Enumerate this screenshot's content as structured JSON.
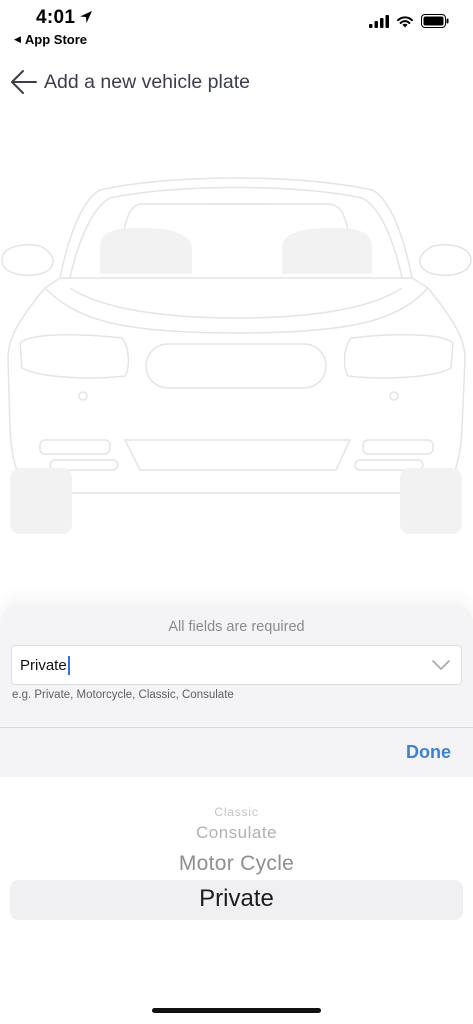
{
  "status_bar": {
    "time": "4:01",
    "back_app": "App Store",
    "icons": [
      "location-icon",
      "signal-icon",
      "wifi-icon",
      "battery-icon"
    ]
  },
  "header": {
    "title": "Add a new vehicle plate"
  },
  "form": {
    "required_note": "All fields are required",
    "plate_type_value": "Private",
    "helper_text": "e.g. Private, Motorcycle, Classic, Consulate"
  },
  "toolbar": {
    "done_label": "Done"
  },
  "picker": {
    "options": [
      "Classic",
      "Consulate",
      "Motor Cycle",
      "Private"
    ],
    "selected": "Private"
  },
  "colors": {
    "accent": "#3b82d6",
    "caret": "#2f6fde",
    "sheet_bg": "#f4f4f6",
    "car_outline": "#e4e4e6"
  }
}
